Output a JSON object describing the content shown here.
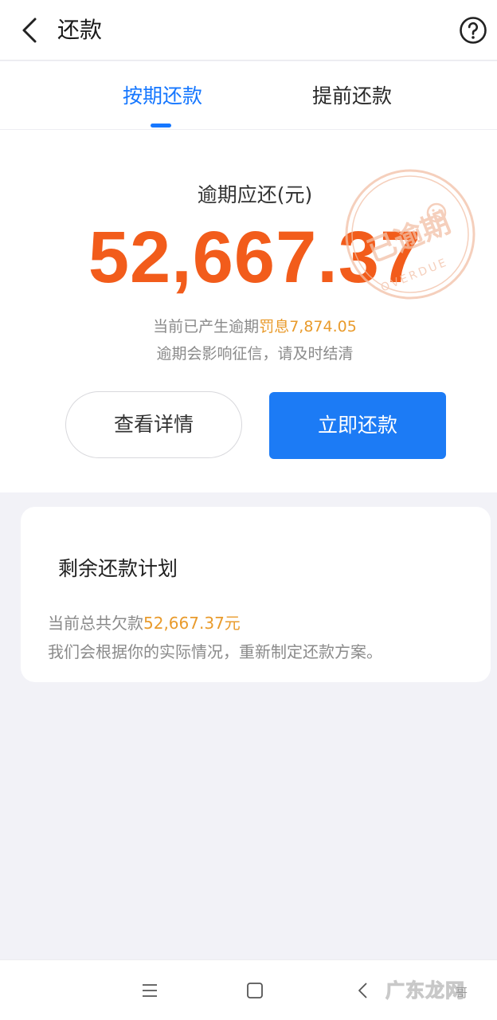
{
  "header": {
    "back_icon": "chevron-left-icon",
    "title": "还款",
    "help_icon": "question-circle-icon"
  },
  "tabs": [
    {
      "label": "按期还款",
      "active": true
    },
    {
      "label": "提前还款",
      "active": false
    }
  ],
  "summary": {
    "label": "逾期应还(元)",
    "amount": "52,667.37",
    "penalty_prefix": "当前已产生逾期",
    "penalty_label": "罚息",
    "penalty_amount": "7,874.05",
    "credit_notice": "逾期会影响征信，请及时结清",
    "stamp": {
      "text": "已逾期",
      "subtext": "OVERDUE",
      "icon": "sad-face-icon"
    }
  },
  "actions": {
    "details_label": "查看详情",
    "repay_label": "立即还款"
  },
  "plan": {
    "title": "剩余还款计划",
    "owed_prefix": "当前总共欠款",
    "owed_amount": "52,667.37元",
    "note": "我们会根据你的实际情况，重新制定还款方案。"
  },
  "navbar": {
    "menu_icon": "menu-icon",
    "home_icon": "square-icon",
    "back_icon": "triangle-back-icon"
  },
  "watermark": {
    "text": "广东龙网",
    "sub": "哥"
  },
  "colors": {
    "accent_blue": "#1677ff",
    "button_blue": "#1c7bf5",
    "overdue_orange": "#f25c1b",
    "penalty_gold": "#e99b2c",
    "stamp_color": "#f2c0a6"
  }
}
